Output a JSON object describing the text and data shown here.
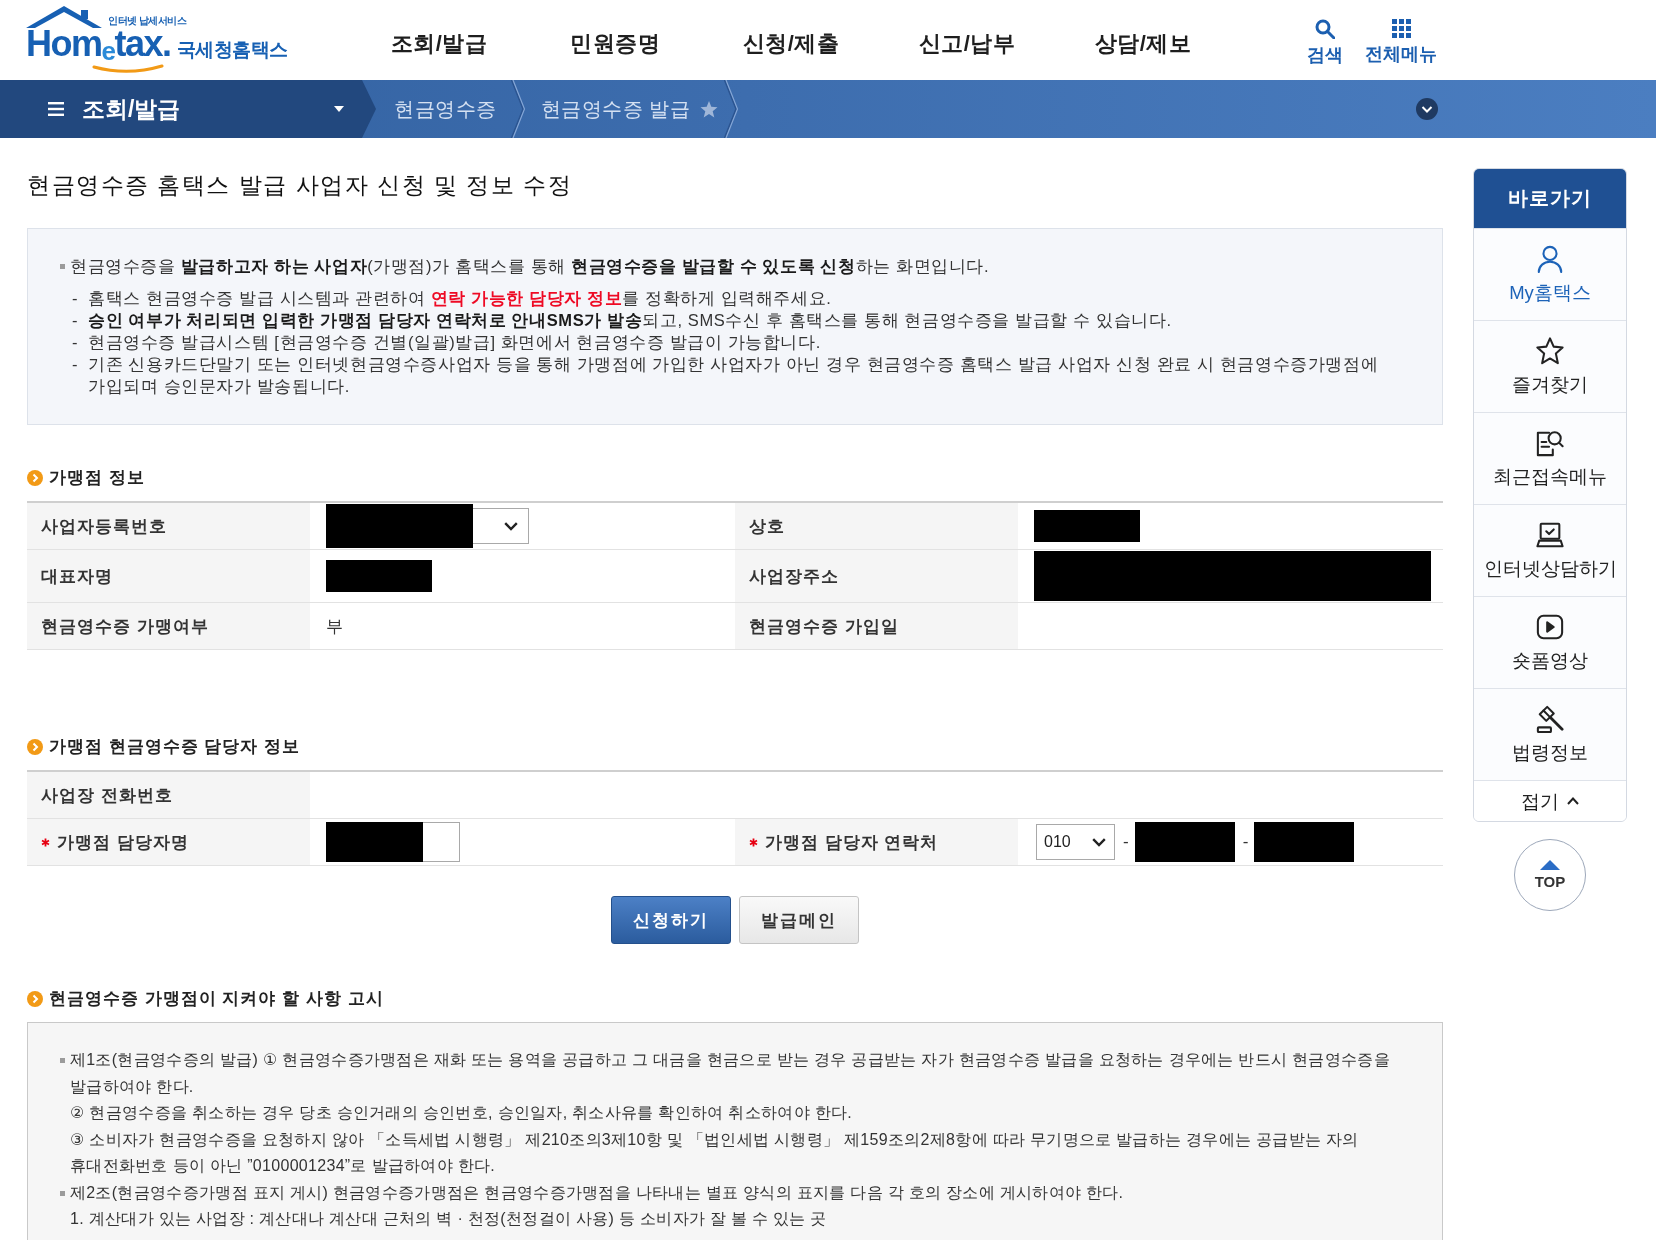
{
  "header": {
    "logo": {
      "tagline": "인터넷 납세서비스",
      "wordmark": "Hom$_{e}$tax.",
      "name": "국세청홈택스"
    },
    "nav": [
      "조회/발급",
      "민원증명",
      "신청/제출",
      "신고/납부",
      "상담/제보"
    ],
    "utilities": [
      {
        "kind": "search",
        "label": "검색"
      },
      {
        "kind": "all-menu",
        "label": "전체메뉴"
      }
    ]
  },
  "breadcrumb": {
    "menu": "조회/발급",
    "items": [
      "현금영수증",
      "현금영수증 발급"
    ],
    "favorited": false
  },
  "page_title": "현금영수증 홈택스 발급 사업자 신청 및 정보 수정",
  "intro": {
    "lead": "현금영수증을 **발급하고자 하는 사업자**(가맹점)가 홈택스를 통해 **현금영수증을 발급할 수 있도록 신청**하는 화면입니다.",
    "notes": [
      {
        "kind": "alert",
        "marker": "-",
        "text": "홈택스 현금영수증 발급 시스템과 관련하여 **연락 가능한 담당자 정보**를 정확하게 입력해주세요."
      },
      {
        "kind": "plain",
        "marker": "-",
        "text": "**승인 여부가 처리되면 입력한 가맹점 담당자 연락처로 안내SMS가 발송**되고, SMS수신 후 홈택스를 통해 현금영수증을 발급할 수 있습니다."
      },
      {
        "kind": "plain",
        "marker": "-",
        "text": "현금영수증 발급시스템 [현금영수증 건별(일괄)발급] 화면에서 현금영수증 발급이 가능합니다."
      },
      {
        "kind": "plain",
        "marker": "-",
        "text": "기존 신용카드단말기 또는 인터넷현금영수증사업자 등을 통해 가맹점에 가입한 사업자가 아닌 경우 현금영수증 홈택스 발급 사업자 신청 완료 시 현금영수증가맹점에 가입되며 승인문자가 발송됩니다."
      }
    ]
  },
  "merchant_info": {
    "heading": "가맹점 정보",
    "rows": [
      [
        {
          "label": "사업자등록번호",
          "kind": "masked-select",
          "required": false
        },
        {
          "label": "상호",
          "kind": "masked",
          "required": false
        }
      ],
      [
        {
          "label": "대표자명",
          "kind": "masked",
          "required": false
        },
        {
          "label": "사업장주소",
          "kind": "masked-wide",
          "required": false
        }
      ],
      [
        {
          "label": "현금영수증 가맹여부",
          "kind": "text",
          "value": "부",
          "required": false
        },
        {
          "label": "현금영수증 가입일",
          "kind": "text",
          "required": false
        }
      ]
    ]
  },
  "contact_info": {
    "heading": "가맹점 현금영수증 담당자 정보",
    "rows": [
      [
        {
          "label": "사업장 전화번호",
          "kind": "text",
          "required": false
        }
      ],
      [
        {
          "label": "가맹점 담당자명",
          "kind": "masked-input",
          "required": true
        },
        {
          "label": "가맹점 담당자 연락처",
          "kind": "phone",
          "required": true,
          "parts": [
            {
              "kind": "select",
              "value": "010"
            },
            {
              "kind": "separator",
              "text": "-"
            },
            {
              "kind": "masked"
            },
            {
              "kind": "separator",
              "text": "-"
            },
            {
              "kind": "masked"
            }
          ]
        }
      ]
    ]
  },
  "actions": [
    {
      "label": "신청하기",
      "kind": "primary"
    },
    {
      "label": "발급메인",
      "kind": "secondary"
    }
  ],
  "notice": {
    "heading": "현금영수증 가맹점이 지켜야 할 사항 고시",
    "items": [
      {
        "kind": "article",
        "text": "제1조(현금영수증의 발급) ① 현금영수증가맹점은 재화 또는 용역을 공급하고 그 대금을 현금으로 받는 경우 공급받는 자가 현금영수증 발급을 요청하는 경우에는 반드시 현금영수증을 발급하여야 한다."
      },
      {
        "kind": "clause",
        "text": "② 현금영수증을 취소하는 경우 당초 승인거래의 승인번호, 승인일자, 취소사유를 확인하여 취소하여야 한다."
      },
      {
        "kind": "clause",
        "text": "③ 소비자가 현금영수증을 요청하지 않아 「소득세법 시행령」 제210조의3제10항 및 「법인세법 시행령」 제159조의2제8항에 따라 무기명으로 발급하는 경우에는 공급받는 자의 휴대전화번호 등이 아닌 ”0100001234”로 발급하여야 한다."
      },
      {
        "kind": "article",
        "text": "제2조(현금영수증가맹점 표지 게시) 현금영수증가맹점은 현금영수증가맹점을 나타내는 별표 양식의 표지를 다음 각 호의 장소에 게시하여야 한다."
      },
      {
        "kind": "clause",
        "text": "1. 계산대가 있는 사업장 : 계산대나 계산대 근처의 벽 · 천정(천정걸이 사용) 등 소비자가 잘 볼 수 있는 곳"
      }
    ]
  },
  "quick_menu": {
    "title": "바로가기",
    "items": [
      {
        "kind": "person",
        "label": "My홈택스",
        "highlighted": true
      },
      {
        "kind": "star",
        "label": "즐겨찾기",
        "highlighted": false
      },
      {
        "kind": "recent",
        "label": "최근접속메뉴",
        "highlighted": false
      },
      {
        "kind": "consult",
        "label": "인터넷상담하기",
        "highlighted": false
      },
      {
        "kind": "video",
        "label": "숏폼영상",
        "highlighted": false
      },
      {
        "kind": "law",
        "label": "법령정보",
        "highlighted": false
      }
    ],
    "collapse": "접기",
    "top": "TOP"
  }
}
